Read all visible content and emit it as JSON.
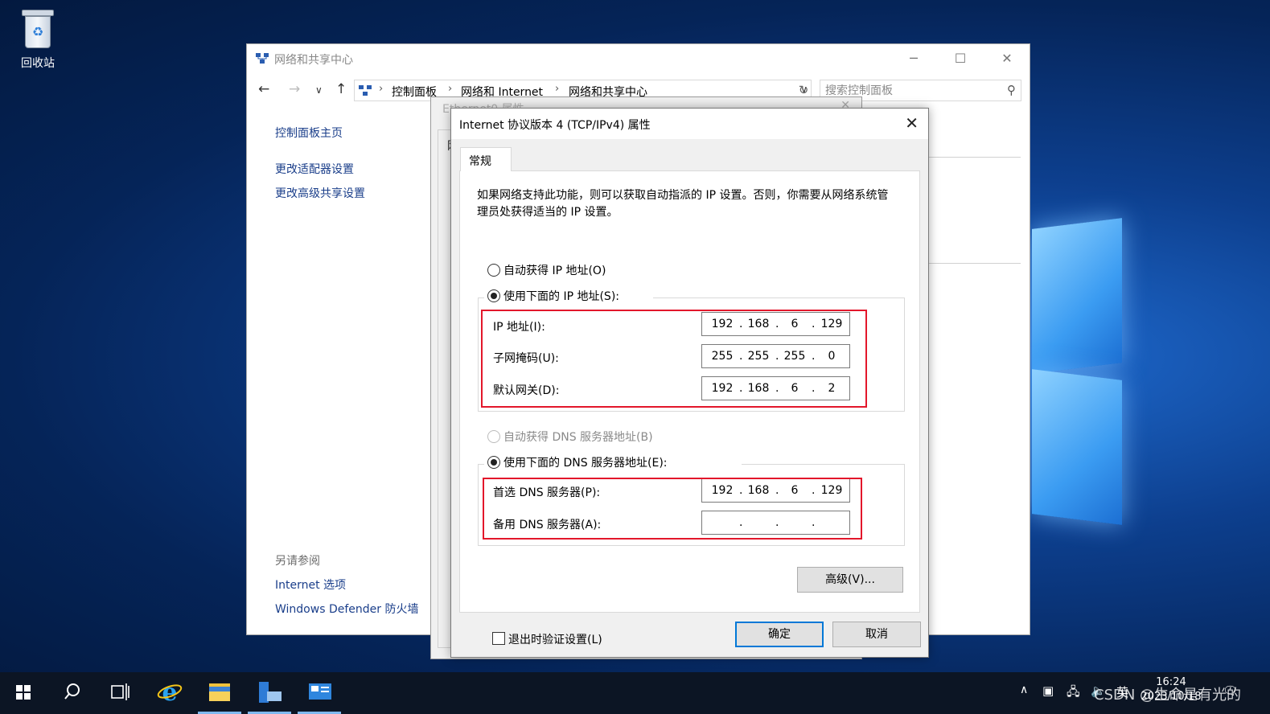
{
  "desktop": {
    "recycle_bin": "回收站"
  },
  "nsc_window": {
    "title": "网络和共享中心",
    "breadcrumb": [
      "控制面板",
      "网络和 Internet",
      "网络和共享中心"
    ],
    "search_placeholder": "搜索控制面板",
    "sidebar": {
      "home": "控制面板主页",
      "adapter": "更改适配器设置",
      "sharing": "更改高级共享设置"
    },
    "see_also": {
      "header": "另请参阅",
      "internet_options": "Internet 选项",
      "firewall": "Windows Defender 防火墙"
    }
  },
  "eth_dialog": {
    "title": "Ethernet0 属性",
    "tab_initial": "网"
  },
  "ipv4_dialog": {
    "title": "Internet 协议版本 4 (TCP/IPv4) 属性",
    "tab": "常规",
    "description": "如果网络支持此功能，则可以获取自动指派的 IP 设置。否则，你需要从网络系统管理员处获得适当的 IP 设置。",
    "auto_ip_label": "自动获得 IP 地址(O)",
    "manual_ip_label": "使用下面的 IP 地址(S):",
    "ip_label": "IP 地址(I):",
    "ip": [
      "192",
      "168",
      "6",
      "129"
    ],
    "mask_label": "子网掩码(U):",
    "mask": [
      "255",
      "255",
      "255",
      "0"
    ],
    "gateway_label": "默认网关(D):",
    "gateway": [
      "192",
      "168",
      "6",
      "2"
    ],
    "auto_dns_label": "自动获得 DNS 服务器地址(B)",
    "manual_dns_label": "使用下面的 DNS 服务器地址(E):",
    "dns1_label": "首选 DNS 服务器(P):",
    "dns1": [
      "192",
      "168",
      "6",
      "129"
    ],
    "dns2_label": "备用 DNS 服务器(A):",
    "dns2": [
      "",
      "",
      "",
      ""
    ],
    "validate_label": "退出时验证设置(L)",
    "advanced_button": "高级(V)...",
    "ok_button": "确定",
    "cancel_button": "取消"
  },
  "taskbar": {
    "ime": "英",
    "time": "16:24",
    "date": "2023/10/18",
    "watermark": "CSDN @生命是有光的"
  },
  "colors": {
    "highlight_border": "#e3172b",
    "accent": "#0078d7"
  }
}
